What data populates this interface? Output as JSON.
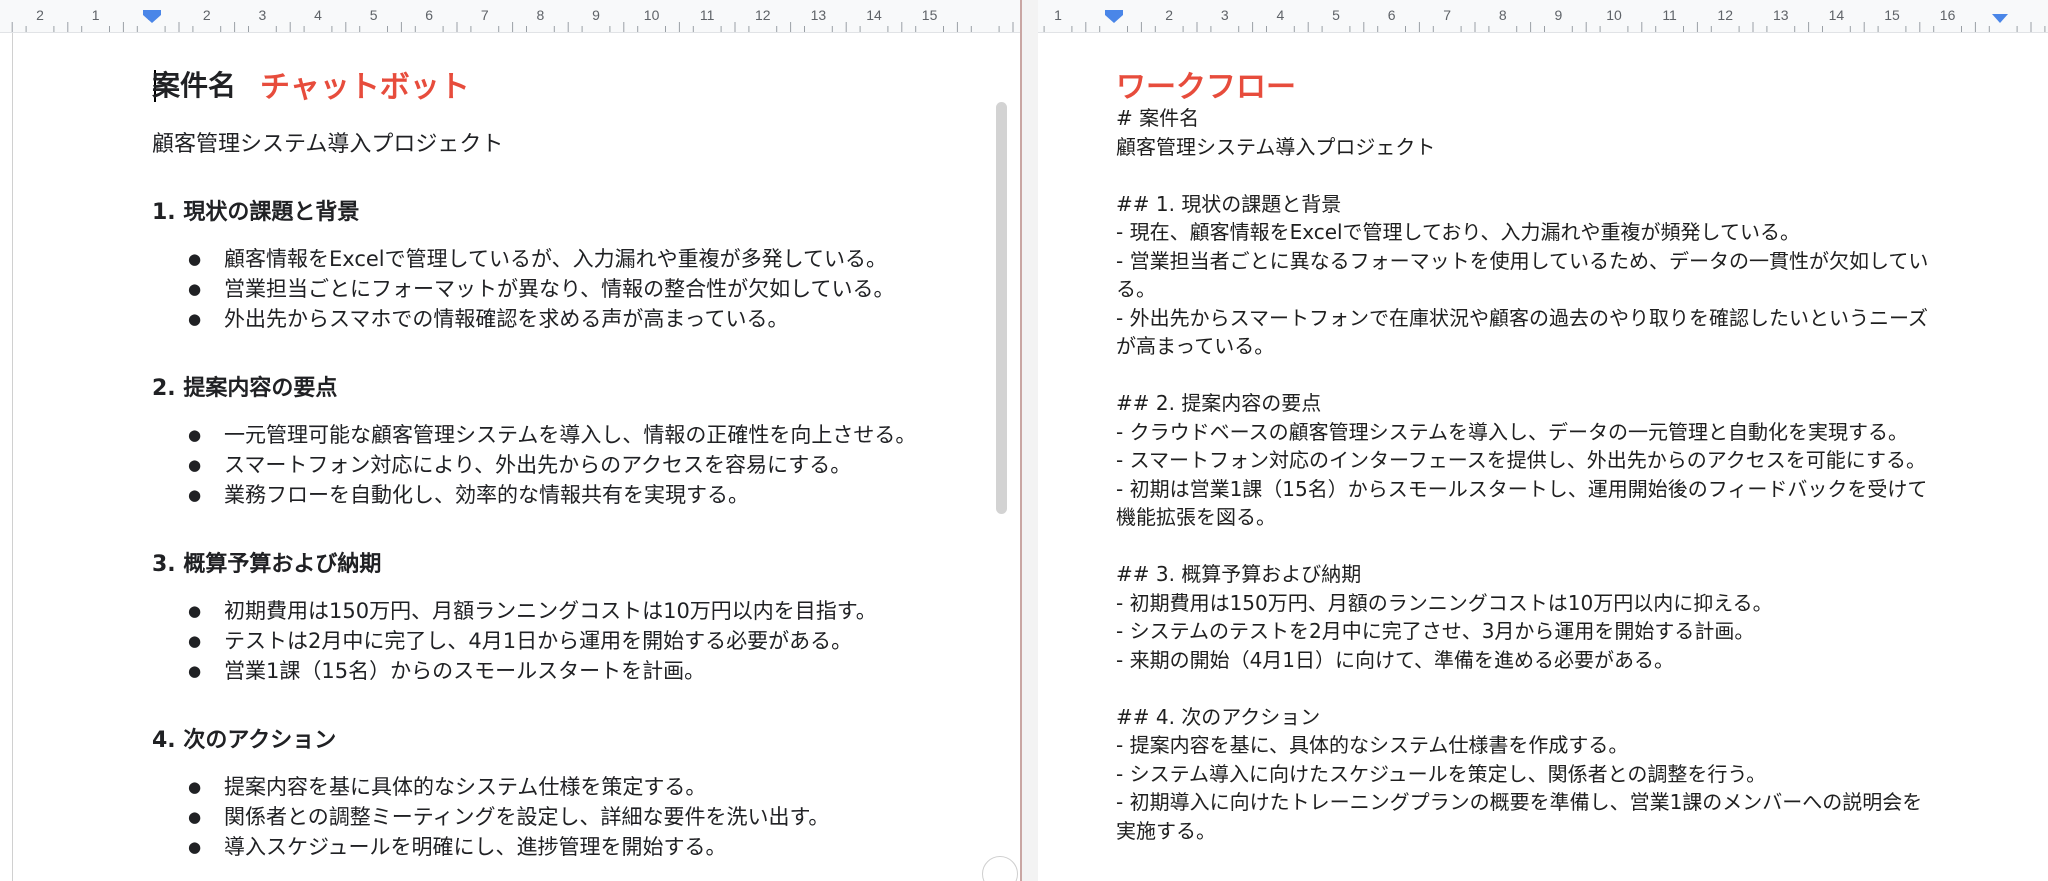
{
  "left_ruler": {
    "labels": [
      "2",
      "1",
      "1",
      "2",
      "3",
      "4",
      "5",
      "6",
      "7",
      "8",
      "9",
      "10",
      "11",
      "12",
      "13",
      "14",
      "15"
    ]
  },
  "right_ruler": {
    "labels": [
      "1",
      "1",
      "2",
      "3",
      "4",
      "5",
      "6",
      "7",
      "8",
      "9",
      "10",
      "11",
      "12",
      "13",
      "14",
      "15",
      "16"
    ]
  },
  "left_doc": {
    "title": "案件名",
    "chat_label": "チャットボット",
    "project_name": "顧客管理システム導入プロジェクト",
    "sections": [
      {
        "heading": "1. 現状の課題と背景",
        "items": [
          "顧客情報をExcelで管理しているが、入力漏れや重複が多発している。",
          "営業担当ごとにフォーマットが異なり、情報の整合性が欠如している。",
          "外出先からスマホでの情報確認を求める声が高まっている。"
        ]
      },
      {
        "heading": "2. 提案内容の要点",
        "items": [
          "一元管理可能な顧客管理システムを導入し、情報の正確性を向上させる。",
          "スマートフォン対応により、外出先からのアクセスを容易にする。",
          "業務フローを自動化し、効率的な情報共有を実現する。"
        ]
      },
      {
        "heading": "3. 概算予算および納期",
        "items": [
          "初期費用は150万円、月額ランニングコストは10万円以内を目指す。",
          "テストは2月中に完了し、4月1日から運用を開始する必要がある。",
          "営業1課（15名）からのスモールスタートを計画。"
        ]
      },
      {
        "heading": "4. 次のアクション",
        "items": [
          "提案内容を基に具体的なシステム仕様を策定する。",
          "関係者との調整ミーティングを設定し、詳細な要件を洗い出す。",
          "導入スケジュールを明確にし、進捗管理を開始する。"
        ]
      }
    ]
  },
  "right_doc": {
    "title": "ワークフロー",
    "lines": [
      "# 案件名",
      "顧客管理システム導入プロジェクト",
      "",
      "## 1. 現状の課題と背景",
      "- 現在、顧客情報をExcelで管理しており、入力漏れや重複が頻発している。",
      "- 営業担当者ごとに異なるフォーマットを使用しているため、データの一貫性が欠如してい",
      "る。",
      "- 外出先からスマートフォンで在庫状況や顧客の過去のやり取りを確認したいというニーズ",
      "が高まっている。",
      "",
      "## 2. 提案内容の要点",
      "- クラウドベースの顧客管理システムを導入し、データの一元管理と自動化を実現する。",
      "- スマートフォン対応のインターフェースを提供し、外出先からのアクセスを可能にする。",
      "- 初期は営業1課（15名）からスモールスタートし、運用開始後のフィードバックを受けて",
      "機能拡張を図る。",
      "",
      "## 3. 概算予算および納期",
      "- 初期費用は150万円、月額のランニングコストは10万円以内に抑える。",
      "- システムのテストを2月中に完了させ、3月から運用を開始する計画。",
      "- 来期の開始（4月1日）に向けて、準備を進める必要がある。",
      "",
      "## 4. 次のアクション",
      "- 提案内容を基に、具体的なシステム仕様書を作成する。",
      "- システム導入に向けたスケジュールを策定し、関係者との調整を行う。",
      "- 初期導入に向けたトレーニングプランの概要を準備し、営業1課のメンバーへの説明会を",
      "実施する。"
    ]
  },
  "colors": {
    "accent_red": "#e74c3c",
    "ruler_marker": "#4a86e8"
  }
}
